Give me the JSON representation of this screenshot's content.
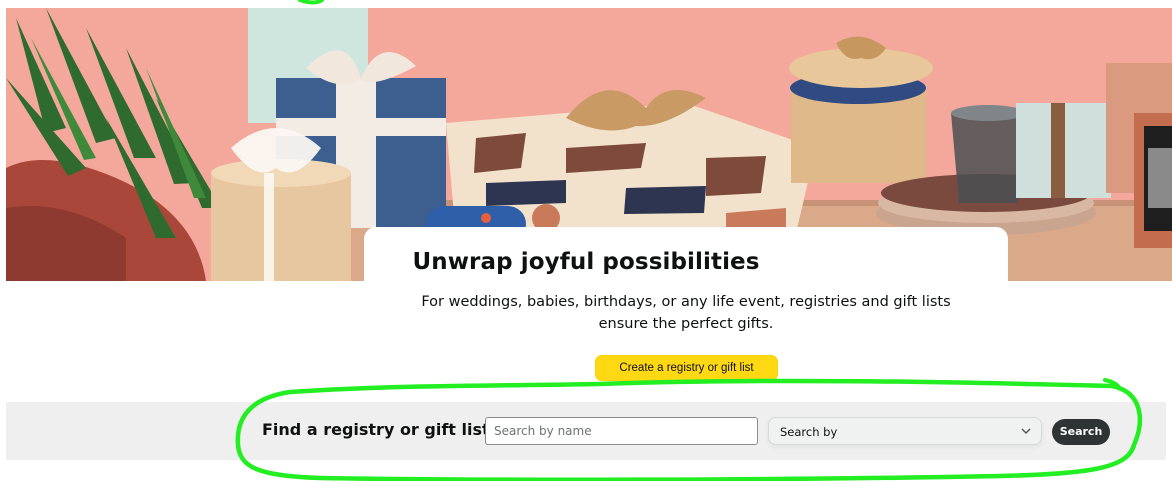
{
  "hero": {
    "image_icon": "gift-boxes-photo",
    "accent_color": "#f2a69a"
  },
  "headline": "Unwrap joyful possibilities",
  "subtext": "For weddings, babies, birthdays, or any life event, registries and gift lists ensure the perfect gifts.",
  "create_button": {
    "label": "Create a registry or gift list",
    "color": "#ffd814"
  },
  "find": {
    "label": "Find a registry or gift list",
    "search_input": {
      "placeholder": "Search by name",
      "value": ""
    },
    "search_by": {
      "selected": "Search by",
      "icon": "chevron-down-icon"
    },
    "search_button": "Search"
  },
  "annotation": {
    "color": "#22ee22",
    "shape": "hand-drawn-ellipse"
  }
}
